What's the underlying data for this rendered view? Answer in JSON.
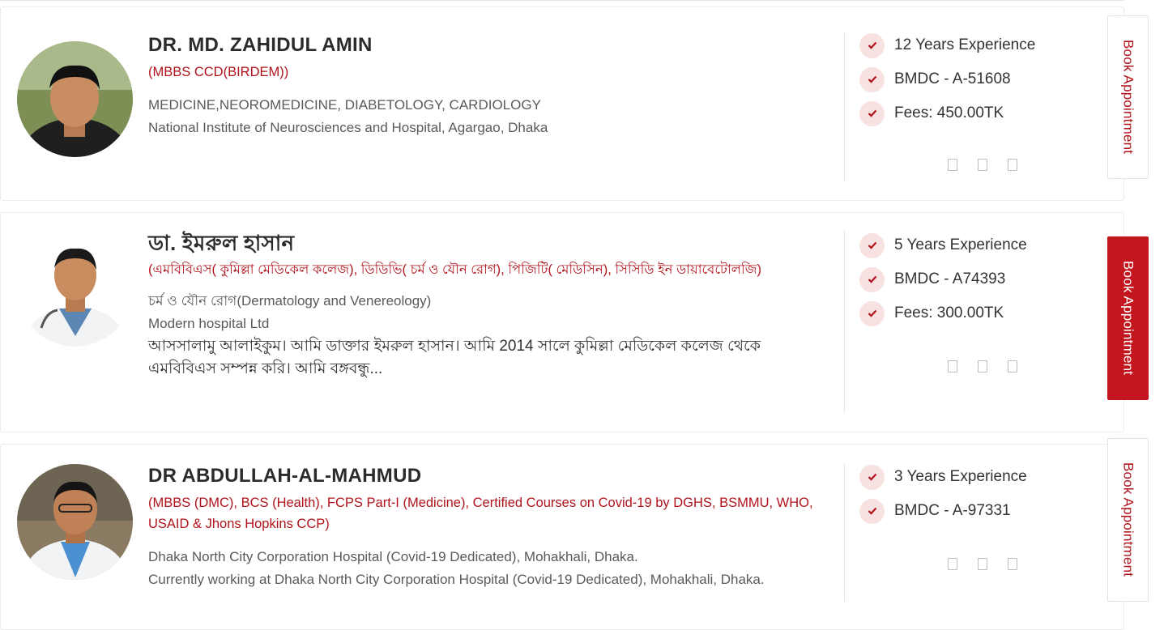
{
  "doctors": [
    {
      "name": "DR. MD. ZAHIDUL AMIN",
      "qualifications": "(MBBS CCD(BIRDEM))",
      "specialty": "MEDICINE,NEOROMEDICINE, DIABETOLOGY, CARDIOLOGY",
      "hospital": "National Institute of Neurosciences and Hospital, Agargao, Dhaka",
      "experience": "12 Years Experience",
      "bmdc": "BMDC - A-51608",
      "fees": "Fees: 450.00TK",
      "book_label": "Book Appointment"
    },
    {
      "name": "ডা. ইমরুল হাসান",
      "qualifications": "(এমবিবিএস( কুমিল্লা মেডিকেল কলেজ), ডিডিভি( চর্ম ও যৌন রোগ), পিজিটি( মেডিসিন), সিসিডি ইন ডায়াবেটোলজি)",
      "specialty": "চর্ম ও যৌন রোগ(Dermatology and Venereology)",
      "hospital": "Modern hospital Ltd",
      "bio": "আসসালামু আলাইকুম। আমি ডাক্তার ইমরুল হাসান।   আমি  2014 সালে  কুমিল্লা মেডিকেল কলেজ থেকে  এমবিবিএস সম্পন্ন করি।   আমি বঙ্গবন্ধু...",
      "experience": "5 Years Experience",
      "bmdc": "BMDC - A74393",
      "fees": "Fees: 300.00TK",
      "book_label": "Book Appointment"
    },
    {
      "name": "DR ABDULLAH-AL-MAHMUD",
      "qualifications": "(MBBS (DMC), BCS (Health), FCPS Part-I (Medicine), Certified Courses on Covid-19 by DGHS, BSMMU, WHO, USAID & Jhons Hopkins CCP)",
      "specialty": "Dhaka North City Corporation Hospital (Covid-19 Dedicated), Mohakhali, Dhaka.",
      "hospital": "Currently working at Dhaka North City Corporation Hospital (Covid-19 Dedicated), Mohakhali, Dhaka.",
      "experience": "3 Years Experience",
      "bmdc": "BMDC - A-97331",
      "book_label": "Book Appointment"
    }
  ],
  "colors": {
    "accent": "#b0131b",
    "book_active": "#c3161e",
    "check_bg": "#f8e1e1"
  },
  "icons": {
    "check": "checkmark-icon",
    "square": "social-placeholder-icon"
  }
}
